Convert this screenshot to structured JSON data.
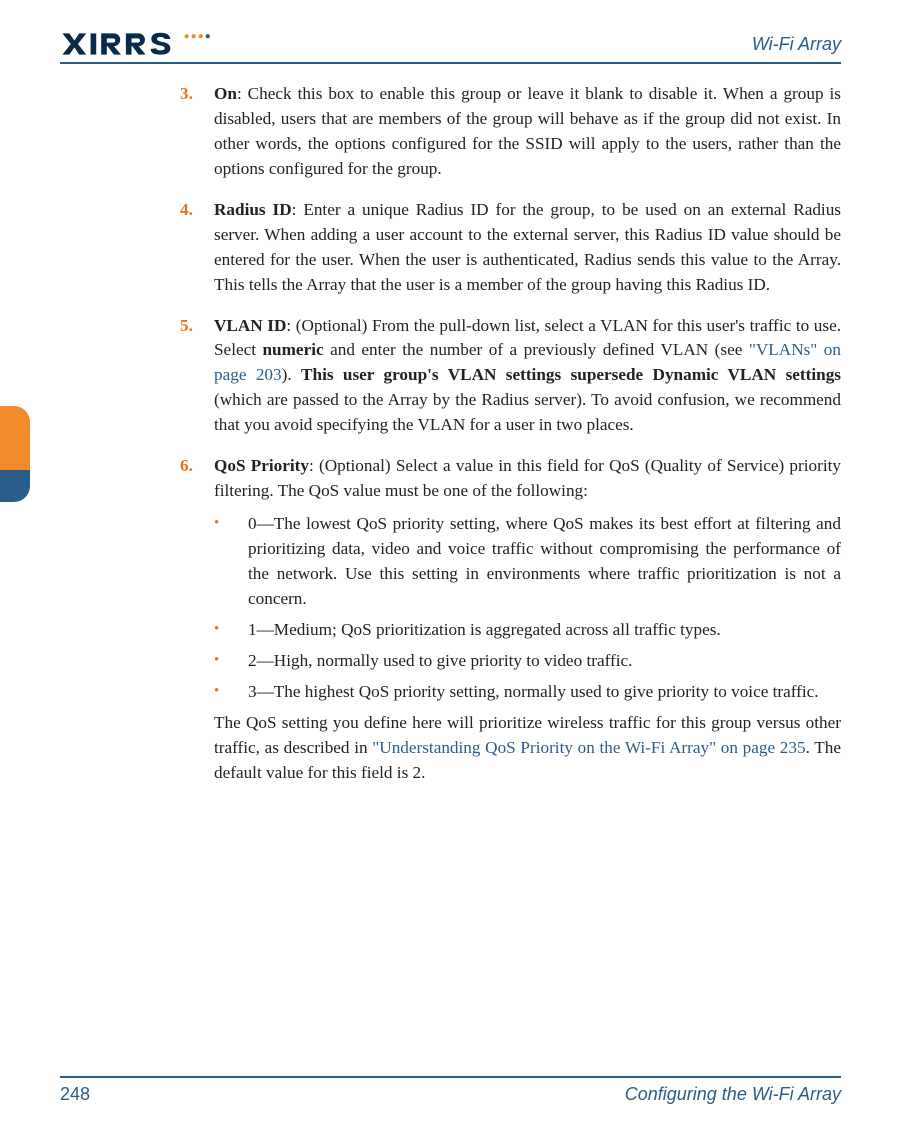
{
  "header": {
    "brand": "XIRRUS",
    "doc_title": "Wi-Fi Array"
  },
  "items": [
    {
      "num": "3.",
      "title": "On",
      "body": ": Check this box to enable this group or leave it blank to disable it. When a group is disabled, users that are members of the group will behave as if the group did not exist. In other words, the options configured for the SSID will apply to the users, rather than the options configured for the group."
    },
    {
      "num": "4.",
      "title": "Radius ID",
      "body": ": Enter a unique Radius ID for the group, to be used on an external Radius server. When adding a user account to the external server, this Radius ID value should be entered for the user. When the user is authenticated, Radius sends this value to the Array. This tells the Array that the user is a member of the group having this Radius ID."
    },
    {
      "num": "5.",
      "title": "VLAN ID",
      "body_pre": ": (Optional) From the pull-down list, select a VLAN for this user's traffic to use. Select ",
      "body_bold1": "numeric",
      "body_mid": " and enter the number of a previously defined VLAN (see ",
      "link": "\"VLANs\" on page 203",
      "body_post1": "). ",
      "body_bold2": "This user group's VLAN settings supersede Dynamic VLAN settings",
      "body_post2": " (which are passed to the Array by the Radius server). To avoid confusion, we recommend that you avoid specifying the VLAN for a user in two places."
    },
    {
      "num": "6.",
      "title": "QoS Priority",
      "body": ": (Optional) Select a value in this field for QoS (Quality of Service) priority filtering. The QoS value must be one of the following:",
      "subs": [
        "0—The lowest QoS priority setting, where QoS makes its best effort at filtering and prioritizing data, video and voice traffic without compromising the performance of the network. Use this setting in environments where traffic prioritization is not a concern.",
        "1—Medium; QoS prioritization is aggregated across all traffic types.",
        "2—High, normally used to give priority to video traffic.",
        "3—The highest QoS priority setting, normally used to give priority to voice traffic."
      ],
      "trail_pre": "The QoS setting you define here will prioritize wireless traffic for this group versus other traffic, as described in ",
      "trail_link": "\"Understanding QoS Priority on the Wi-Fi Array\" on page 235",
      "trail_post": ". The default value for this field is 2."
    }
  ],
  "footer": {
    "page": "248",
    "section": "Configuring the Wi-Fi Array"
  }
}
